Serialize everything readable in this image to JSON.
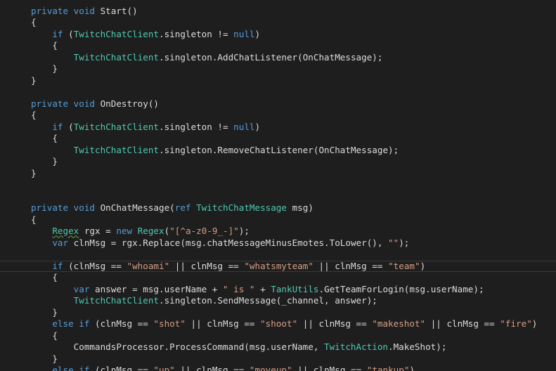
{
  "colors": {
    "background": "#1e1e1e",
    "text": "#dcdcdc",
    "keyword": "#569cd6",
    "type": "#4ec9b0",
    "string": "#d69d85"
  },
  "code_lines": [
    [
      [
        "kw",
        "private void "
      ],
      [
        "",
        "Start()"
      ]
    ],
    [
      [
        "",
        "{"
      ]
    ],
    [
      [
        "",
        "    "
      ],
      [
        "kw",
        "if"
      ],
      [
        "",
        " ("
      ],
      [
        "ty",
        "TwitchChatClient"
      ],
      [
        "",
        ".singleton != "
      ],
      [
        "kw",
        "null"
      ],
      [
        "",
        ")"
      ]
    ],
    [
      [
        "",
        "    {"
      ]
    ],
    [
      [
        "",
        "        "
      ],
      [
        "ty",
        "TwitchChatClient"
      ],
      [
        "",
        ".singleton.AddChatListener(OnChatMessage);"
      ]
    ],
    [
      [
        "",
        "    }"
      ]
    ],
    [
      [
        "",
        "}"
      ]
    ],
    [
      [
        "",
        ""
      ]
    ],
    [
      [
        "kw",
        "private void "
      ],
      [
        "",
        "OnDestroy()"
      ]
    ],
    [
      [
        "",
        "{"
      ]
    ],
    [
      [
        "",
        "    "
      ],
      [
        "kw",
        "if"
      ],
      [
        "",
        " ("
      ],
      [
        "ty",
        "TwitchChatClient"
      ],
      [
        "",
        ".singleton != "
      ],
      [
        "kw",
        "null"
      ],
      [
        "",
        ")"
      ]
    ],
    [
      [
        "",
        "    {"
      ]
    ],
    [
      [
        "",
        "        "
      ],
      [
        "ty",
        "TwitchChatClient"
      ],
      [
        "",
        ".singleton.RemoveChatListener(OnChatMessage);"
      ]
    ],
    [
      [
        "",
        "    }"
      ]
    ],
    [
      [
        "",
        "}"
      ]
    ],
    [
      [
        "",
        ""
      ]
    ],
    [
      [
        "",
        ""
      ]
    ],
    [
      [
        "kw",
        "private void "
      ],
      [
        "",
        "OnChatMessage("
      ],
      [
        "kw",
        "ref "
      ],
      [
        "ty",
        "TwitchChatMessage"
      ],
      [
        "",
        " msg)"
      ]
    ],
    [
      [
        "",
        "{"
      ]
    ],
    [
      [
        "",
        "    "
      ],
      [
        "ty sq",
        "Regex"
      ],
      [
        "",
        " rgx = "
      ],
      [
        "kw",
        "new "
      ],
      [
        "ty",
        "Regex"
      ],
      [
        "",
        "("
      ],
      [
        "st",
        "\"[^a-z0-9_-]\""
      ],
      [
        "",
        ");"
      ]
    ],
    [
      [
        "",
        "    "
      ],
      [
        "kw",
        "var"
      ],
      [
        "",
        " clnMsg = rgx.Replace(msg.chatMessageMinusEmotes.ToLower(), "
      ],
      [
        "st",
        "\"\""
      ],
      [
        "",
        ");"
      ]
    ],
    [
      [
        "",
        ""
      ]
    ],
    [
      [
        "",
        "    "
      ],
      [
        "kw",
        "if"
      ],
      [
        "",
        " (clnMsg == "
      ],
      [
        "st",
        "\"whoami\""
      ],
      [
        "",
        " || clnMsg == "
      ],
      [
        "st",
        "\"whatsmyteam\""
      ],
      [
        "",
        " || clnMsg == "
      ],
      [
        "st",
        "\"team\""
      ],
      [
        "",
        ")"
      ]
    ],
    [
      [
        "",
        "    {"
      ]
    ],
    [
      [
        "",
        "        "
      ],
      [
        "kw",
        "var"
      ],
      [
        "",
        " answer = msg.userName + "
      ],
      [
        "st",
        "\" is \""
      ],
      [
        "",
        " + "
      ],
      [
        "ty",
        "TankUtils"
      ],
      [
        "",
        ".GetTeamForLogin(msg.userName);"
      ]
    ],
    [
      [
        "",
        "        "
      ],
      [
        "ty",
        "TwitchChatClient"
      ],
      [
        "",
        ".singleton.SendMessage(_channel, answer);"
      ]
    ],
    [
      [
        "",
        "    }"
      ]
    ],
    [
      [
        "",
        "    "
      ],
      [
        "kw",
        "else if"
      ],
      [
        "",
        " (clnMsg == "
      ],
      [
        "st",
        "\"shot\""
      ],
      [
        "",
        " || clnMsg == "
      ],
      [
        "st",
        "\"shoot\""
      ],
      [
        "",
        " || clnMsg == "
      ],
      [
        "st",
        "\"makeshot\""
      ],
      [
        "",
        " || clnMsg == "
      ],
      [
        "st",
        "\"fire\""
      ],
      [
        "",
        ")"
      ]
    ],
    [
      [
        "",
        "    {"
      ]
    ],
    [
      [
        "",
        "        CommandsProcessor.ProcessCommand(msg.userName, "
      ],
      [
        "ty",
        "TwitchAction"
      ],
      [
        "",
        ".MakeShot);"
      ]
    ],
    [
      [
        "",
        "    }"
      ]
    ],
    [
      [
        "",
        "    "
      ],
      [
        "kw",
        "else if"
      ],
      [
        "",
        " (clnMsg == "
      ],
      [
        "st",
        "\"up\""
      ],
      [
        "",
        " || clnMsg == "
      ],
      [
        "st",
        "\"moveup\""
      ],
      [
        "",
        " || clnMsg == "
      ],
      [
        "st",
        "\"tankup\""
      ],
      [
        "",
        ")"
      ]
    ]
  ]
}
